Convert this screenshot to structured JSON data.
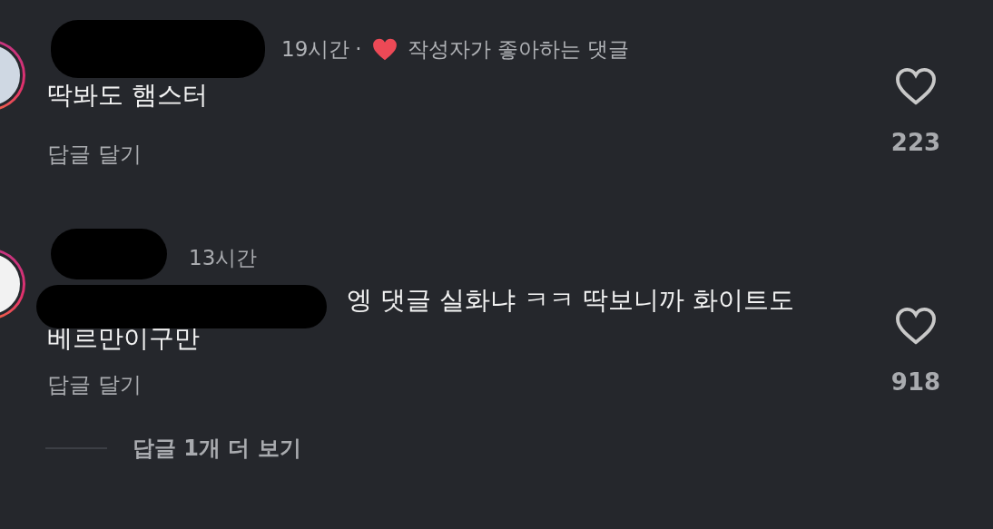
{
  "comments": [
    {
      "time": "19시간",
      "author_liked": true,
      "separator": "·",
      "author_liked_label": "작성자가 좋아하는 댓글",
      "mention_redacted": false,
      "body": "딱봐도 햄스터",
      "reply": "답글 달기",
      "liked": false,
      "likes": "223"
    },
    {
      "time": "13시간",
      "author_liked": false,
      "mention_redacted": true,
      "body": "엥 댓글 실화냐 ㅋㅋ 딱보니까 화이트도 베르만이구만",
      "reply": "답글 달기",
      "liked": false,
      "likes": "918"
    }
  ],
  "more_replies": "답글 1개 더 보기"
}
